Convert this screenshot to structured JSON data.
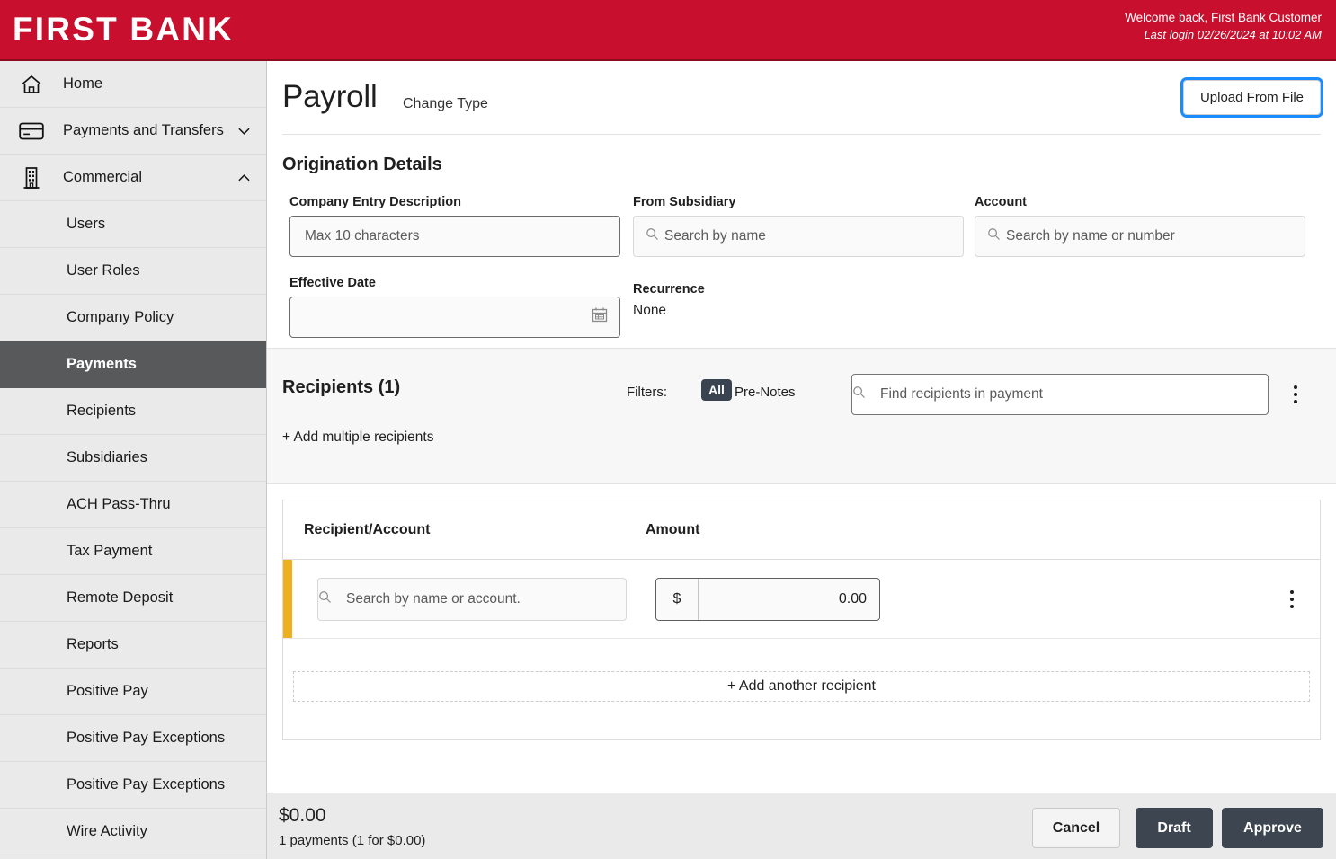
{
  "header": {
    "brand": "FIRST BANK",
    "welcome": "Welcome back, First Bank Customer",
    "last_login": "Last login 02/26/2024 at 10:02 AM",
    "brand_color": "#c8102e"
  },
  "sidebar": {
    "items": [
      {
        "label": "Home",
        "icon": "home-icon",
        "level": "top",
        "chevron": "",
        "active": false
      },
      {
        "label": "Payments and Transfers",
        "icon": "card-icon",
        "level": "top",
        "chevron": "down",
        "active": false
      },
      {
        "label": "Commercial",
        "icon": "building-icon",
        "level": "top",
        "chevron": "up",
        "active": false
      },
      {
        "label": "Users",
        "icon": "",
        "level": "sub",
        "chevron": "",
        "active": false
      },
      {
        "label": "User Roles",
        "icon": "",
        "level": "sub",
        "chevron": "",
        "active": false
      },
      {
        "label": "Company Policy",
        "icon": "",
        "level": "sub",
        "chevron": "",
        "active": false
      },
      {
        "label": "Payments",
        "icon": "",
        "level": "sub",
        "chevron": "",
        "active": true
      },
      {
        "label": "Recipients",
        "icon": "",
        "level": "sub",
        "chevron": "",
        "active": false
      },
      {
        "label": "Subsidiaries",
        "icon": "",
        "level": "sub",
        "chevron": "",
        "active": false
      },
      {
        "label": "ACH Pass-Thru",
        "icon": "",
        "level": "sub",
        "chevron": "",
        "active": false
      },
      {
        "label": "Tax Payment",
        "icon": "",
        "level": "sub",
        "chevron": "",
        "active": false
      },
      {
        "label": "Remote Deposit",
        "icon": "",
        "level": "sub",
        "chevron": "",
        "active": false
      },
      {
        "label": "Reports",
        "icon": "",
        "level": "sub",
        "chevron": "",
        "active": false
      },
      {
        "label": "Positive Pay",
        "icon": "",
        "level": "sub",
        "chevron": "",
        "active": false
      },
      {
        "label": "Positive Pay Exceptions",
        "icon": "",
        "level": "sub",
        "chevron": "",
        "active": false
      },
      {
        "label": "Positive Pay Exceptions",
        "icon": "",
        "level": "sub",
        "chevron": "",
        "active": false
      },
      {
        "label": "Wire Activity",
        "icon": "",
        "level": "sub",
        "chevron": "",
        "active": false
      }
    ],
    "active_color": "#58595b"
  },
  "page": {
    "title": "Payroll",
    "change_type": "Change Type",
    "upload_button": "Upload From File",
    "focus_ring_color": "#1a8cff"
  },
  "origination": {
    "heading": "Origination Details",
    "company_entry_description": {
      "label": "Company Entry Description",
      "placeholder": "Max 10 characters",
      "value": ""
    },
    "from_subsidiary": {
      "label": "From Subsidiary",
      "placeholder": "Search by name",
      "value": ""
    },
    "account": {
      "label": "Account",
      "placeholder": "Search by name or number",
      "value": ""
    },
    "effective_date": {
      "label": "Effective Date",
      "placeholder": "",
      "value": ""
    },
    "recurrence": {
      "label": "Recurrence",
      "value": "None"
    }
  },
  "recipients_band": {
    "title": "Recipients (1)",
    "filters_label": "Filters:",
    "filter_all": "All",
    "filter_prenotes": "Pre-Notes",
    "find_placeholder": "Find recipients in payment",
    "find_value": "",
    "add_multiple": "+ Add multiple recipients",
    "badge_color": "#3a4450"
  },
  "table": {
    "columns": [
      "Recipient/Account",
      "Amount"
    ],
    "rows": [
      {
        "recipient_placeholder": "Search by name or account.",
        "recipient_value": "",
        "currency_symbol": "$",
        "amount": "0.00",
        "accent_color": "#edb01f"
      }
    ],
    "add_another": "+ Add another recipient"
  },
  "footer": {
    "total": "$0.00",
    "summary": "1 payments (1 for $0.00)",
    "cancel": "Cancel",
    "draft": "Draft",
    "approve": "Approve",
    "dark_button_color": "#3d4650"
  }
}
